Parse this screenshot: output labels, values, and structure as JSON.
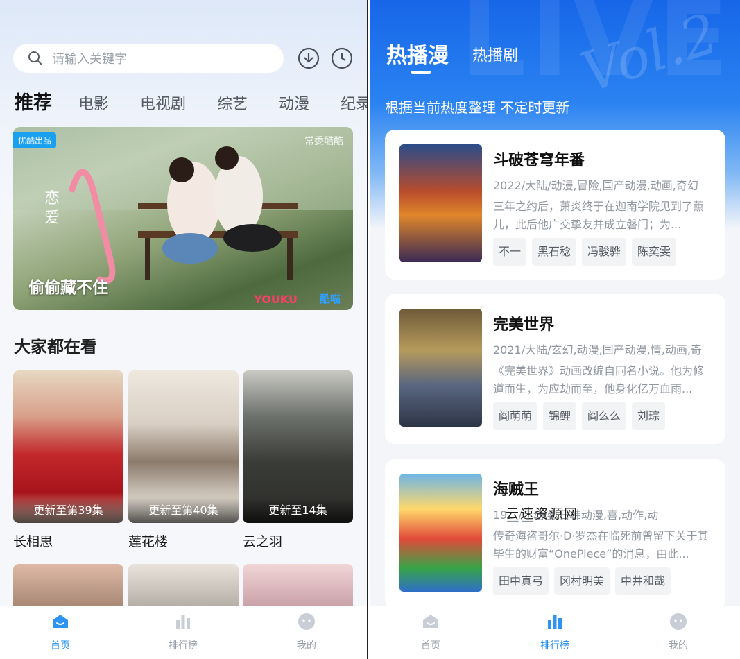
{
  "left": {
    "search": {
      "placeholder": "请输入关键字"
    },
    "categories": [
      "推荐",
      "电影",
      "电视剧",
      "综艺",
      "动漫",
      "纪录"
    ],
    "banner": {
      "badge": "优酷出品",
      "title": "偷偷藏不住",
      "logo1": "YOUKU",
      "logo2": "酷喵",
      "corner": "常委酷酷"
    },
    "section_title": "大家都在看",
    "cards": [
      {
        "name": "长相思",
        "update": "更新至第39集"
      },
      {
        "name": "莲花楼",
        "update": "更新至第40集"
      },
      {
        "name": "云之羽",
        "update": "更新至14集"
      }
    ],
    "tabbar": [
      "首页",
      "排行榜",
      "我的"
    ]
  },
  "right": {
    "tabs": [
      "热播漫",
      "热播剧"
    ],
    "subtitle": "根据当前热度整理 不定时更新",
    "deco": "Vol.2",
    "items": [
      {
        "title": "斗破苍穹年番",
        "meta": "2022/大陆/动漫,冒险,国产动漫,动画,奇幻",
        "desc": "三年之约后，萧炎终于在迦南学院见到了薰儿，此后他广交挚友并成立磐门；为...",
        "tags": [
          "不一",
          "黑石稔",
          "冯骏骅",
          "陈奕雯"
        ]
      },
      {
        "title": "完美世界",
        "meta": "2021/大陆/玄幻,动漫,国产动漫,情,动画,奇",
        "desc": "《完美世界》动画改编自同名小说。他为修道而生，为应劫而至，他身化亿万血雨...",
        "tags": [
          "阎萌萌",
          "锦鲤",
          "阎么么",
          "刘琮"
        ]
      },
      {
        "title": "海贼王",
        "meta": "19__/__动漫,日韩动漫,喜,动作,动",
        "desc": "传奇海盗哥尔·D·罗杰在临死前曾留下关于其毕生的财富“OnePiece”的消息，由此...",
        "tags": [
          "田中真弓",
          "冈村明美",
          "中井和哉"
        ]
      }
    ],
    "watermark": "云速资源网",
    "tabbar": [
      "首页",
      "排行榜",
      "我的"
    ]
  },
  "colors": {
    "accent": "#1f8ef1",
    "header_blue": "#1766e8"
  }
}
